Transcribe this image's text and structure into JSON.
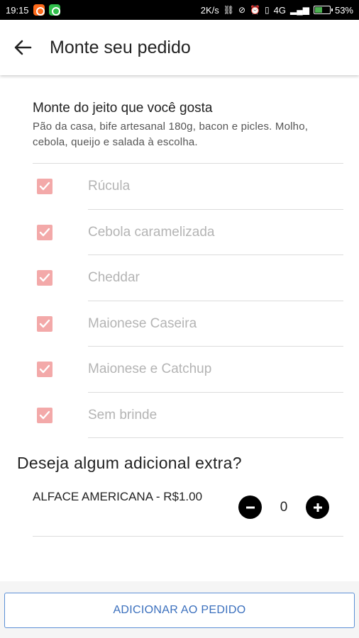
{
  "status_bar": {
    "time": "19:15",
    "network_speed": "2K/s",
    "network_type": "4G",
    "battery": "53%",
    "battery_level": 0.53,
    "app_icons": [
      "orange-app-icon",
      "green-app-icon"
    ]
  },
  "app_bar": {
    "title": "Monte seu pedido",
    "back_icon": "arrow-left-icon"
  },
  "description": {
    "title": "Monte do jeito que você gosta",
    "text": "Pão da casa, bife artesanal 180g, bacon e picles. Molho, cebola, queijo e salada à escolha."
  },
  "options": [
    {
      "label": "Rúcula",
      "checked": true
    },
    {
      "label": "Cebola caramelizada",
      "checked": true
    },
    {
      "label": "Cheddar",
      "checked": true
    },
    {
      "label": "Maionese Caseira",
      "checked": true
    },
    {
      "label": "Maionese e Catchup",
      "checked": true
    },
    {
      "label": "Sem brinde",
      "checked": true
    }
  ],
  "extras": {
    "title": "Deseja algum adicional extra?",
    "items": [
      {
        "label": "ALFACE AMERICANA - R$1.00",
        "quantity": "0"
      }
    ]
  },
  "footer": {
    "add_button": "ADICIONAR AO PEDIDO"
  },
  "colors": {
    "checkbox": "#f3a9a9",
    "button_text": "#3a6fbd",
    "button_border": "#5b8fd6"
  }
}
